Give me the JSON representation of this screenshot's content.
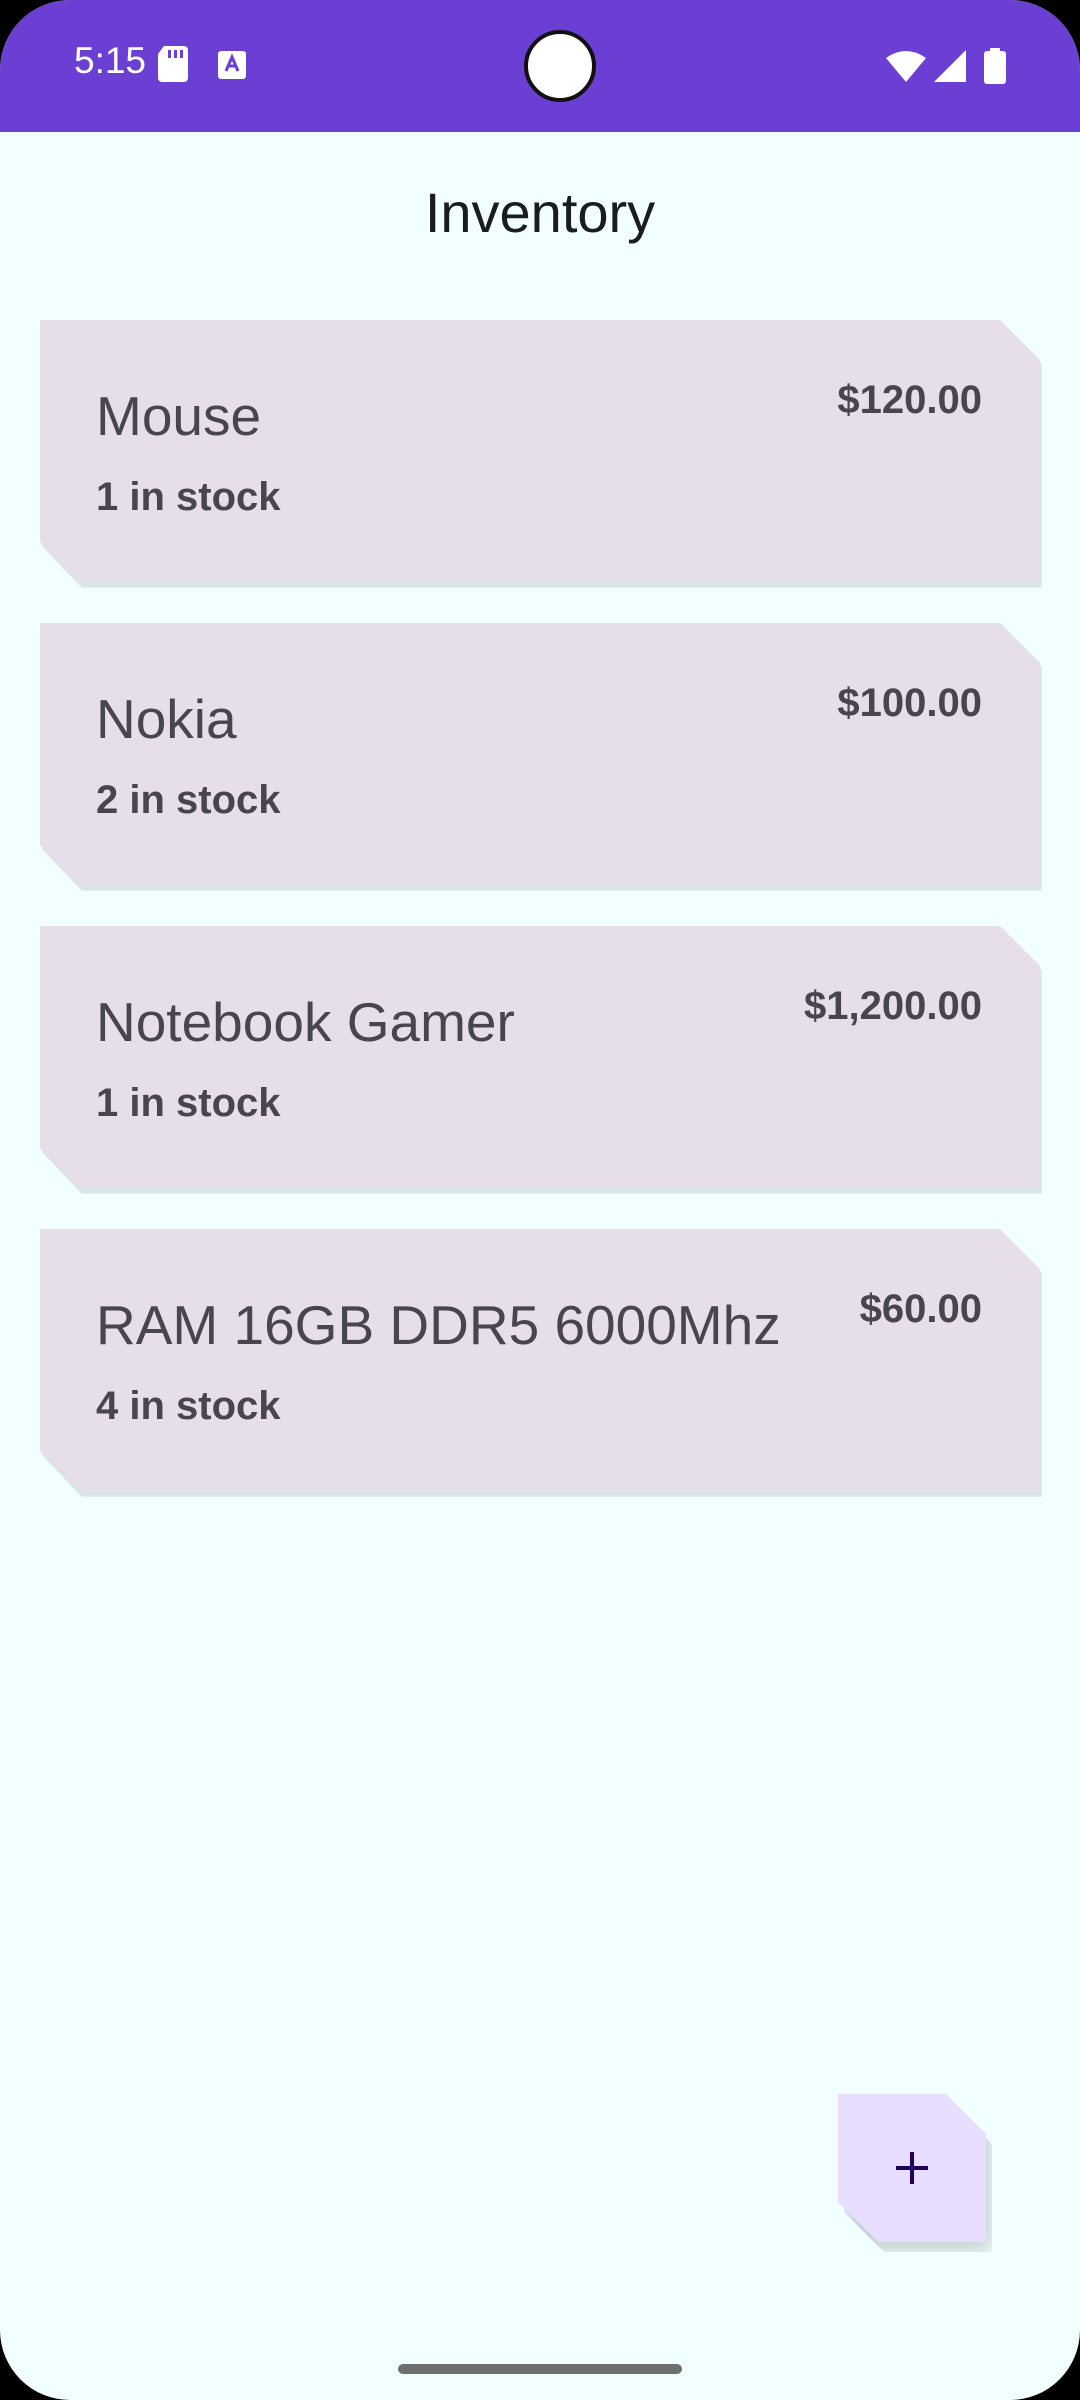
{
  "status_bar": {
    "time": "5:15",
    "icons": [
      "sd-card-icon",
      "keyboard-a-icon",
      "wifi-icon",
      "cell-signal-icon",
      "battery-icon"
    ],
    "color": "#6B3FD3"
  },
  "header": {
    "title": "Inventory"
  },
  "items": [
    {
      "name": "Mouse",
      "stock": "1 in stock",
      "price": "$120.00"
    },
    {
      "name": "Nokia",
      "stock": "2 in stock",
      "price": "$100.00"
    },
    {
      "name": "Notebook Gamer",
      "stock": "1 in stock",
      "price": "$1,200.00"
    },
    {
      "name": "RAM 16GB DDR5 6000Mhz",
      "stock": "4 in stock",
      "price": "$60.00"
    }
  ],
  "fab": {
    "icon": "plus-icon",
    "color": "#E7DEFF"
  },
  "colors": {
    "background": "#F1FFFE",
    "card": "#E6DEE9",
    "text": "#48454F"
  }
}
